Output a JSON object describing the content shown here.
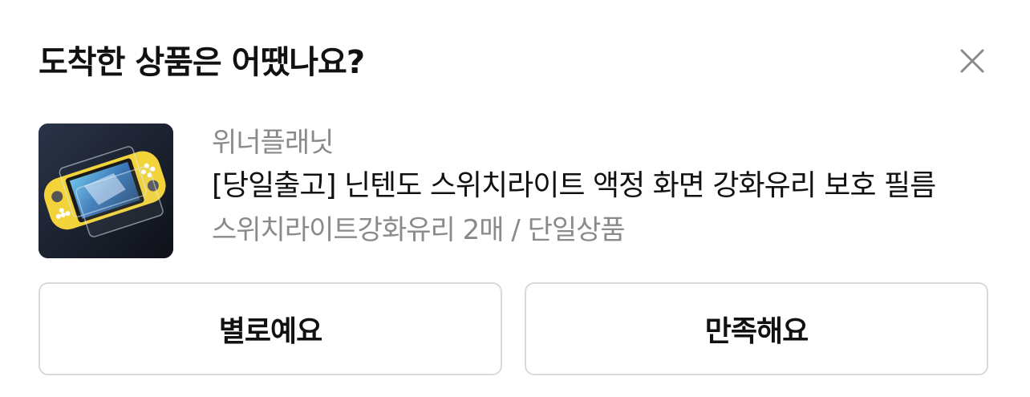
{
  "dialog": {
    "title": "도착한 상품은 어땠나요?",
    "close_icon": "close-icon"
  },
  "product": {
    "image_icon": "product-thumbnail",
    "seller": "위너플래닛",
    "name": "[당일출고] 닌텐도 스위치라이트 액정 화면 강화유리 보호 필름",
    "option": "스위치라이트강화유리 2매 / 단일상품"
  },
  "actions": {
    "negative_label": "별로예요",
    "positive_label": "만족해요"
  },
  "colors": {
    "title": "#111111",
    "secondary_text": "#8a8a8a",
    "button_border": "#d9d9d9",
    "close_icon": "#8a8a8a"
  }
}
